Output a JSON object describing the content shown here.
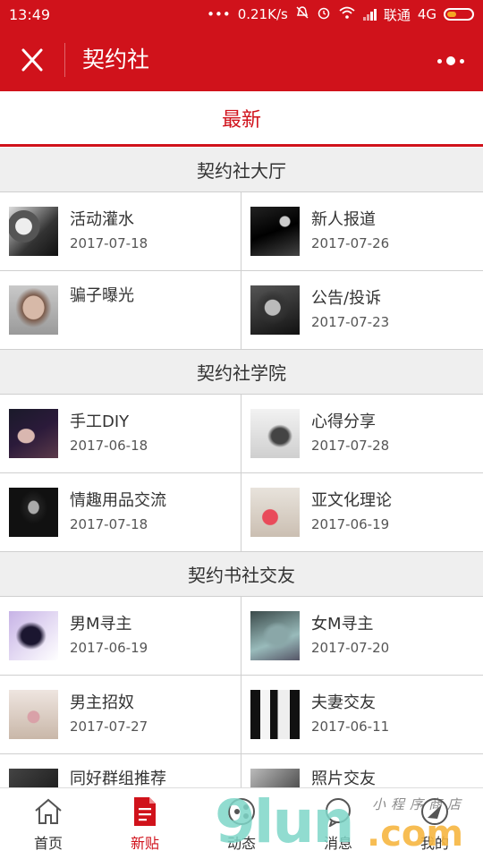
{
  "status_bar": {
    "time": "13:49",
    "dots": "•••",
    "net_speed": "0.21K/s",
    "carrier": "联通",
    "network": "4G"
  },
  "app_bar": {
    "title": "契约社"
  },
  "tab": {
    "label": "最新"
  },
  "sections": [
    {
      "title": "契约社大厅",
      "items": [
        {
          "title": "活动灌水",
          "date": "2017-07-18"
        },
        {
          "title": "新人报道",
          "date": "2017-07-26"
        },
        {
          "title": "骗子曝光",
          "date": ""
        },
        {
          "title": "公告/投诉",
          "date": "2017-07-23"
        }
      ]
    },
    {
      "title": "契约社学院",
      "items": [
        {
          "title": "手工DIY",
          "date": "2017-06-18"
        },
        {
          "title": "心得分享",
          "date": "2017-07-28"
        },
        {
          "title": "情趣用品交流",
          "date": "2017-07-18"
        },
        {
          "title": "亚文化理论",
          "date": "2017-06-19"
        }
      ]
    },
    {
      "title": "契约书社交友",
      "items": [
        {
          "title": "男M寻主",
          "date": "2017-06-19"
        },
        {
          "title": "女M寻主",
          "date": "2017-07-20"
        },
        {
          "title": "男主招奴",
          "date": "2017-07-27"
        },
        {
          "title": "夫妻交友",
          "date": "2017-06-11"
        },
        {
          "title": "同好群组推荐",
          "date": ""
        },
        {
          "title": "照片交友",
          "date": ""
        }
      ]
    }
  ],
  "bottom_nav": [
    {
      "label": "首页",
      "icon": "home-icon",
      "active": false
    },
    {
      "label": "新贴",
      "icon": "new-post-icon",
      "active": true
    },
    {
      "label": "动态",
      "icon": "activity-icon",
      "active": false
    },
    {
      "label": "消息",
      "icon": "message-icon",
      "active": false
    },
    {
      "label": "我的",
      "icon": "profile-icon",
      "active": false
    }
  ],
  "watermark": {
    "brand": "9lun",
    "tld": ".com",
    "small_text": "小程序商店"
  },
  "colors": {
    "accent": "#d0121b",
    "section_bg": "#efefef",
    "divider": "#cfcfcf"
  }
}
